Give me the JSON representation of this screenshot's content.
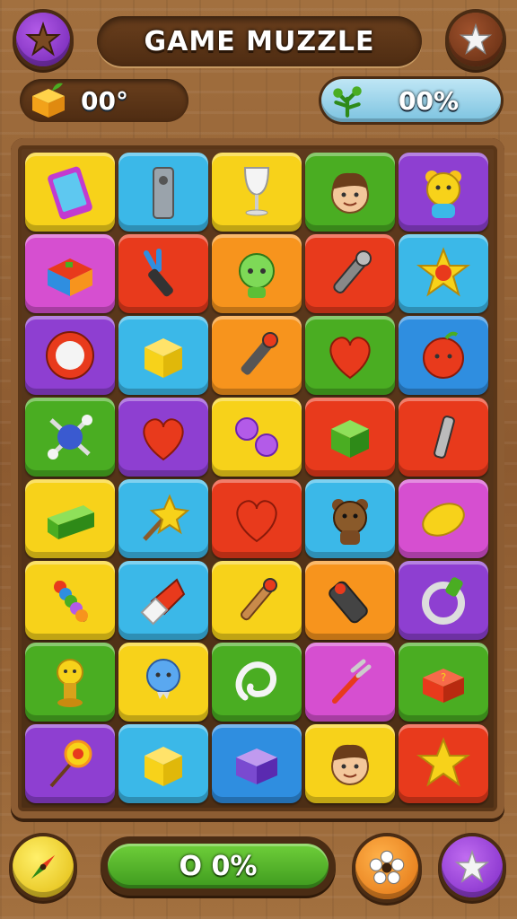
{
  "header": {
    "title": "GAME MUZZLE",
    "menu_icon": "star-badge-icon",
    "favorite_icon": "star-icon"
  },
  "stats": {
    "coins_value": "00°",
    "coins_icon": "gold-block-icon",
    "progress_value": "00%",
    "progress_icon": "green-plant-icon"
  },
  "board": {
    "rows": [
      [
        {
          "color": "#f7d21a",
          "icon": "smartphone-icon"
        },
        {
          "color": "#3bb8e8",
          "icon": "flask-bottle-icon"
        },
        {
          "color": "#f7d21a",
          "icon": "wine-glass-icon"
        },
        {
          "color": "#4aad22",
          "icon": "boy-face-icon"
        },
        {
          "color": "#8e3fd1",
          "icon": "yellow-bear-icon"
        }
      ],
      [
        {
          "color": "#d64fd0",
          "icon": "toy-box-icon"
        },
        {
          "color": "#e83a1c",
          "icon": "tuning-fork-icon"
        },
        {
          "color": "#f7941d",
          "icon": "green-alien-icon"
        },
        {
          "color": "#e83a1c",
          "icon": "microphone-icon"
        },
        {
          "color": "#3bb8e8",
          "icon": "red-star-icon"
        }
      ],
      [
        {
          "color": "#8e3fd1",
          "icon": "red-ring-button-icon"
        },
        {
          "color": "#3bb8e8",
          "icon": "yellow-cube-icon"
        },
        {
          "color": "#f7941d",
          "icon": "flashlight-icon"
        },
        {
          "color": "#4aad22",
          "icon": "red-heart-icon"
        },
        {
          "color": "#2f8ee0",
          "icon": "red-apple-face-icon"
        }
      ],
      [
        {
          "color": "#4aad22",
          "icon": "molecule-icon"
        },
        {
          "color": "#8e3fd1",
          "icon": "red-heart-icon"
        },
        {
          "color": "#f7d21a",
          "icon": "purple-bubbles-icon"
        },
        {
          "color": "#e83a1c",
          "icon": "green-cube-icon"
        },
        {
          "color": "#e83a1c",
          "icon": "bolt-icon"
        }
      ],
      [
        {
          "color": "#f7d21a",
          "icon": "green-block-icon"
        },
        {
          "color": "#3bb8e8",
          "icon": "star-wand-icon"
        },
        {
          "color": "#e83a1c",
          "icon": "red-heart-icon"
        },
        {
          "color": "#3bb8e8",
          "icon": "brown-bear-icon"
        },
        {
          "color": "#d64fd0",
          "icon": "lemon-icon"
        }
      ],
      [
        {
          "color": "#f7d21a",
          "icon": "abacus-stack-icon"
        },
        {
          "color": "#3bb8e8",
          "icon": "rocket-icon"
        },
        {
          "color": "#f7d21a",
          "icon": "torch-icon"
        },
        {
          "color": "#f7941d",
          "icon": "battery-icon"
        },
        {
          "color": "#8e3fd1",
          "icon": "silver-ring-icon"
        }
      ],
      [
        {
          "color": "#4aad22",
          "icon": "yellow-pawn-icon"
        },
        {
          "color": "#f7d21a",
          "icon": "blue-balloon-icon"
        },
        {
          "color": "#4aad22",
          "icon": "white-loop-icon"
        },
        {
          "color": "#d64fd0",
          "icon": "red-fork-icon"
        },
        {
          "color": "#4aad22",
          "icon": "question-box-icon"
        }
      ],
      [
        {
          "color": "#8e3fd1",
          "icon": "sunflower-wand-icon"
        },
        {
          "color": "#3bb8e8",
          "icon": "yellow-cube-icon"
        },
        {
          "color": "#2f8ee0",
          "icon": "purple-block-icon"
        },
        {
          "color": "#f7d21a",
          "icon": "boy-face-icon"
        },
        {
          "color": "#e83a1c",
          "icon": "gold-star-icon"
        }
      ]
    ]
  },
  "footer": {
    "progress_label": "O 0%",
    "compass_icon": "compass-icon",
    "settings_icon": "flower-gear-icon",
    "star_icon": "star-icon"
  }
}
